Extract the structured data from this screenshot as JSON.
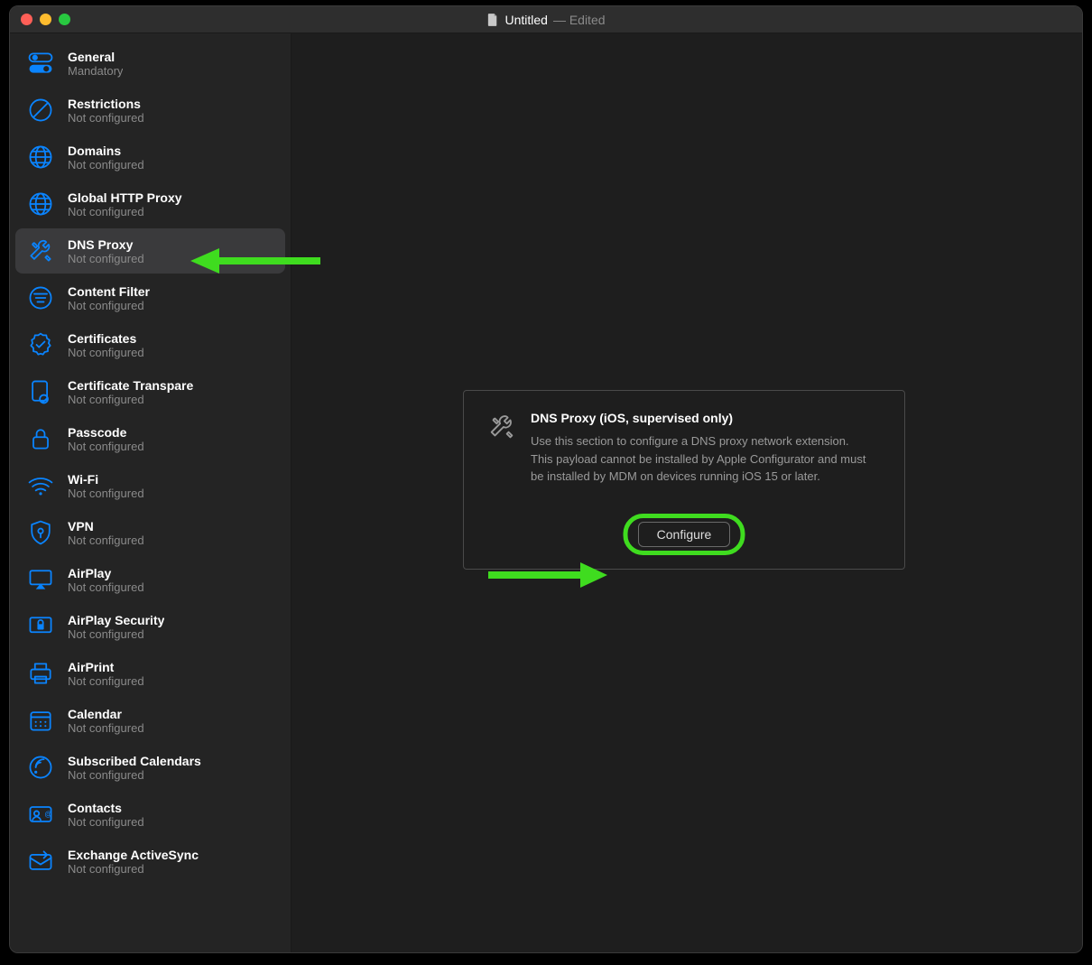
{
  "window": {
    "title": "Untitled",
    "titleSuffix": " — Edited"
  },
  "sidebar": {
    "notConfigured": "Not configured",
    "items": [
      {
        "icon": "toggle",
        "label": "General",
        "sub": "Mandatory",
        "selected": false
      },
      {
        "icon": "nosign",
        "label": "Restrictions",
        "sub": "Not configured",
        "selected": false
      },
      {
        "icon": "globe",
        "label": "Domains",
        "sub": "Not configured",
        "selected": false
      },
      {
        "icon": "globe",
        "label": "Global HTTP Proxy",
        "sub": "Not configured",
        "selected": false
      },
      {
        "icon": "wrench",
        "label": "DNS Proxy",
        "sub": "Not configured",
        "selected": true
      },
      {
        "icon": "filter",
        "label": "Content Filter",
        "sub": "Not configured",
        "selected": false
      },
      {
        "icon": "cert-badge",
        "label": "Certificates",
        "sub": "Not configured",
        "selected": false
      },
      {
        "icon": "cert-doc",
        "label": "Certificate Transpare",
        "sub": "Not configured",
        "selected": false
      },
      {
        "icon": "lock",
        "label": "Passcode",
        "sub": "Not configured",
        "selected": false
      },
      {
        "icon": "wifi",
        "label": "Wi-Fi",
        "sub": "Not configured",
        "selected": false
      },
      {
        "icon": "shield",
        "label": "VPN",
        "sub": "Not configured",
        "selected": false
      },
      {
        "icon": "airplay",
        "label": "AirPlay",
        "sub": "Not configured",
        "selected": false
      },
      {
        "icon": "airplay-lock",
        "label": "AirPlay Security",
        "sub": "Not configured",
        "selected": false
      },
      {
        "icon": "printer",
        "label": "AirPrint",
        "sub": "Not configured",
        "selected": false
      },
      {
        "icon": "calendar",
        "label": "Calendar",
        "sub": "Not configured",
        "selected": false
      },
      {
        "icon": "subscribed",
        "label": "Subscribed Calendars",
        "sub": "Not configured",
        "selected": false
      },
      {
        "icon": "contacts",
        "label": "Contacts",
        "sub": "Not configured",
        "selected": false
      },
      {
        "icon": "exchange",
        "label": "Exchange ActiveSync",
        "sub": "Not configured",
        "selected": false
      }
    ]
  },
  "panel": {
    "title": "DNS Proxy (iOS, supervised only)",
    "description": "Use this section to configure a DNS proxy network extension. This payload cannot be installed by Apple Configurator and must be installed by MDM on devices running iOS 15 or later.",
    "button": "Configure"
  },
  "colors": {
    "accent": "#0a84ff",
    "highlight": "#3fdc1f"
  }
}
